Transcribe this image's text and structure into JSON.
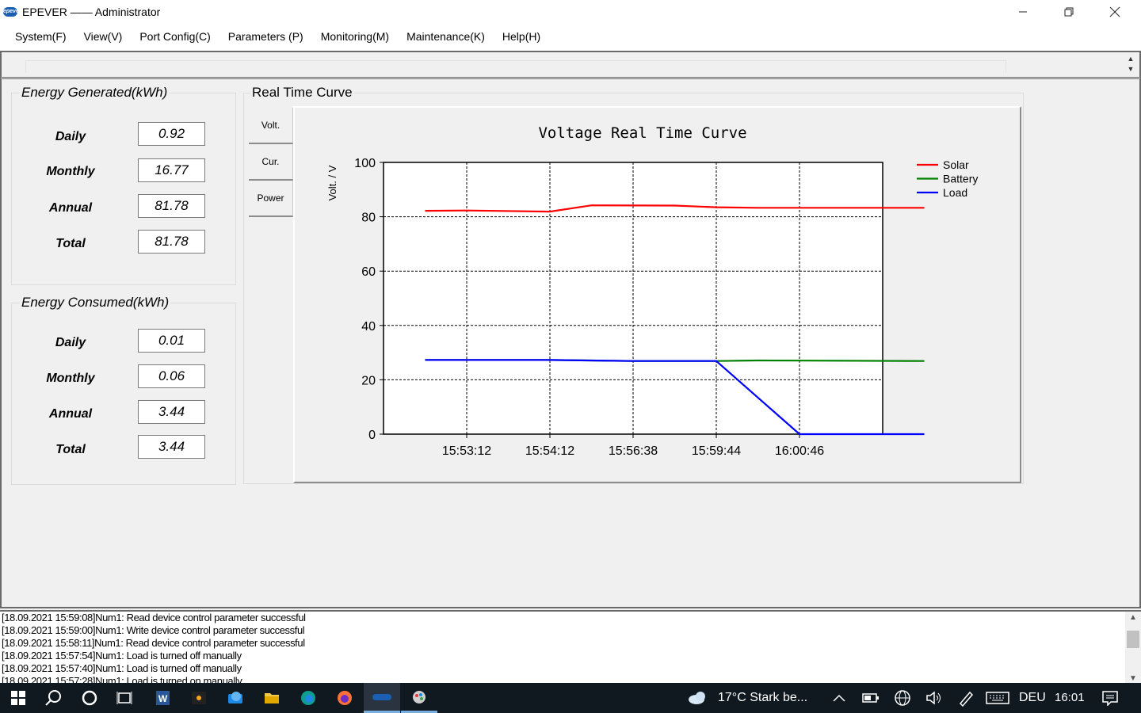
{
  "window": {
    "title": "EPEVER —— Administrator",
    "logo_text": "epever"
  },
  "menu": [
    "System(F)",
    "View(V)",
    "Port Config(C)",
    "Parameters (P)",
    "Monitoring(M)",
    "Maintenance(K)",
    "Help(H)"
  ],
  "energy_generated": {
    "title": "Energy Generated(kWh)",
    "rows": [
      {
        "label": "Daily",
        "value": "0.92"
      },
      {
        "label": "Monthly",
        "value": "16.77"
      },
      {
        "label": "Annual",
        "value": "81.78"
      },
      {
        "label": "Total",
        "value": "81.78"
      }
    ]
  },
  "energy_consumed": {
    "title": "Energy Consumed(kWh)",
    "rows": [
      {
        "label": "Daily",
        "value": "0.01"
      },
      {
        "label": "Monthly",
        "value": "0.06"
      },
      {
        "label": "Annual",
        "value": "3.44"
      },
      {
        "label": "Total",
        "value": "3.44"
      }
    ]
  },
  "curve": {
    "section_title": "Real Time Curve",
    "tabs": [
      "Volt.",
      "Cur.",
      "Power"
    ]
  },
  "chart_data": {
    "type": "line",
    "title": "Voltage Real Time Curve",
    "ylabel": "Volt. / V",
    "xlabel": "",
    "ylim": [
      0,
      100
    ],
    "yticks": [
      0,
      20,
      40,
      60,
      80,
      100
    ],
    "xticks": [
      "15:53:12",
      "15:54:12",
      "15:56:38",
      "15:59:44",
      "16:00:46"
    ],
    "grid": true,
    "legend_position": "top-right",
    "series": [
      {
        "name": "Solar",
        "color": "#ff0000",
        "points": [
          [
            0.5,
            82.2
          ],
          [
            1.0,
            82.3
          ],
          [
            2.0,
            81.9
          ],
          [
            2.5,
            84.2
          ],
          [
            3.5,
            84.1
          ],
          [
            4.0,
            83.5
          ],
          [
            4.5,
            83.3
          ],
          [
            6.5,
            83.3
          ]
        ]
      },
      {
        "name": "Battery",
        "color": "#008000",
        "points": [
          [
            0.5,
            27.3
          ],
          [
            2.0,
            27.3
          ],
          [
            3.0,
            26.9
          ],
          [
            4.0,
            26.9
          ],
          [
            4.5,
            27.1
          ],
          [
            6.5,
            26.9
          ]
        ]
      },
      {
        "name": "Load",
        "color": "#0000ff",
        "points": [
          [
            0.5,
            27.3
          ],
          [
            2.0,
            27.3
          ],
          [
            3.0,
            26.9
          ],
          [
            4.0,
            26.9
          ],
          [
            5.0,
            0
          ],
          [
            6.5,
            0
          ]
        ]
      }
    ]
  },
  "log": [
    "[18.09.2021 15:59:08]Num1: Read device control parameter successful",
    "[18.09.2021 15:59:00]Num1: Write device control parameter successful",
    "[18.09.2021 15:58:11]Num1: Read device control parameter successful",
    "[18.09.2021 15:57:54]Num1: Load is turned off manually",
    "[18.09.2021 15:57:40]Num1: Load is turned off manually",
    "[18.09.2021 15:57:28]Num1: Load is turned on manually"
  ],
  "taskbar": {
    "weather": "17°C  Stark be...",
    "language": "DEU",
    "time": "16:01"
  }
}
